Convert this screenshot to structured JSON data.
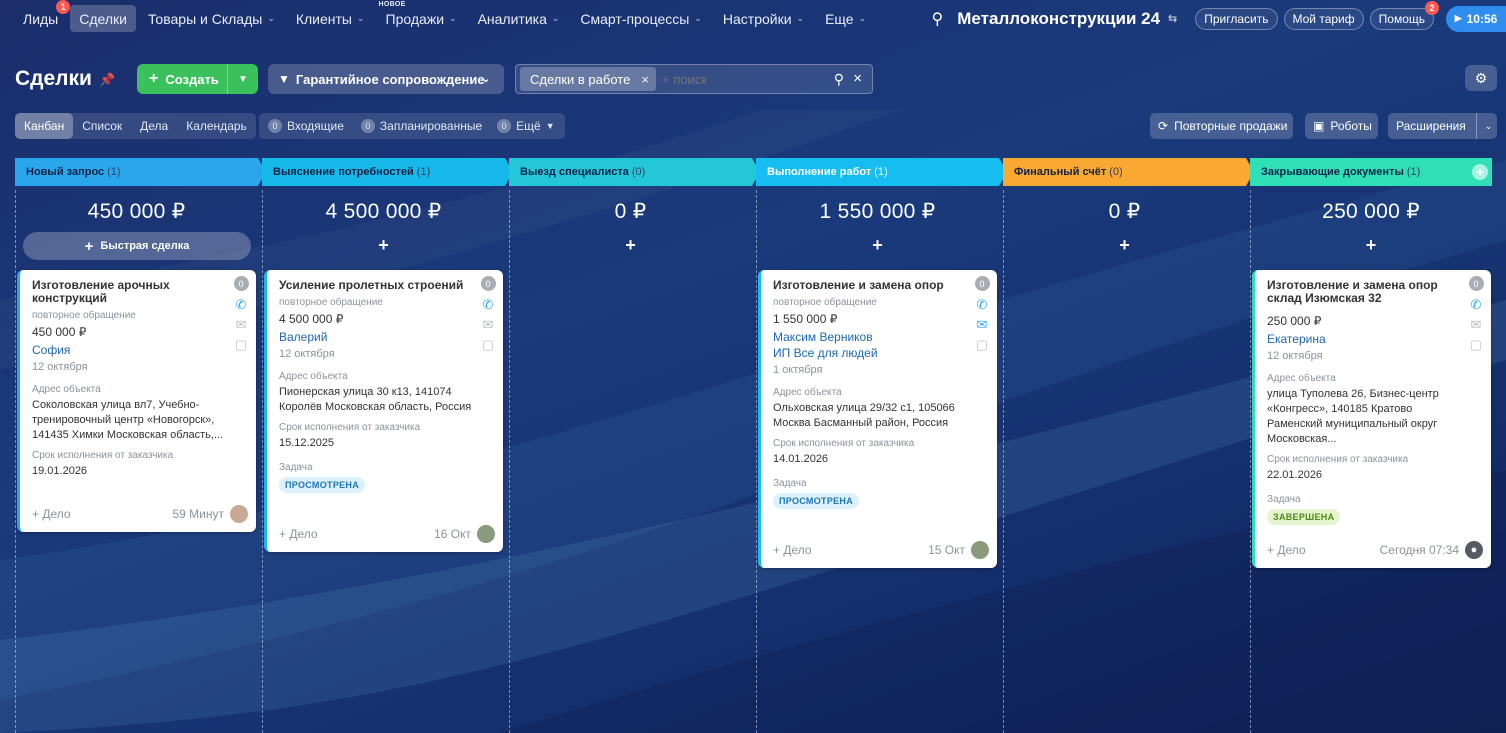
{
  "nav": {
    "items": [
      {
        "label": "Лиды",
        "badge": "1",
        "chev": false,
        "active": false
      },
      {
        "label": "Сделки",
        "badge": "",
        "chev": false,
        "active": true
      },
      {
        "label": "Товары и Склады",
        "badge": "",
        "chev": true,
        "active": false
      },
      {
        "label": "Клиенты",
        "badge": "",
        "chev": true,
        "active": false
      },
      {
        "label": "Продажи",
        "badge": "",
        "chev": true,
        "active": false,
        "tag": "НОВОЕ"
      },
      {
        "label": "Аналитика",
        "badge": "",
        "chev": true,
        "active": false
      },
      {
        "label": "Смарт-процессы",
        "badge": "",
        "chev": true,
        "active": false
      },
      {
        "label": "Настройки",
        "badge": "",
        "chev": true,
        "active": false
      },
      {
        "label": "Еще",
        "badge": "",
        "chev": true,
        "active": false
      }
    ],
    "company": "Металлоконструкции 24",
    "invite": "Пригласить",
    "tariff": "Мой тариф",
    "help": "Помощь",
    "help_badge": "2",
    "clock": "10:56"
  },
  "header": {
    "title": "Сделки",
    "create": "Создать",
    "pipeline": "Гарантийное сопровождение",
    "filter_chip": "Сделки в работе",
    "search_placeholder": "+ поиск"
  },
  "views": [
    "Канбан",
    "Список",
    "Дела",
    "Календарь"
  ],
  "counters": {
    "incoming_count": "0",
    "incoming": "Входящие",
    "planned_count": "0",
    "planned": "Запланированные",
    "more_count": "0",
    "more": "Ещё"
  },
  "actions": {
    "repeat_sales": "Повторные продажи",
    "robots": "Роботы",
    "extensions": "Расширения"
  },
  "colors": {
    "stage1": "#2aa7ec",
    "stage2": "#17b9ea",
    "stage3": "#23c7d8",
    "stage4": "#15bdf0",
    "stage5": "#f9a931",
    "stage6": "#2fdfb7"
  },
  "columns": [
    {
      "name": "Новый запрос",
      "count": "(1)",
      "sum": "450 000 ₽",
      "quick": "Быстрая сделка"
    },
    {
      "name": "Выяснение потребностей",
      "count": "(1)",
      "sum": "4 500 000 ₽"
    },
    {
      "name": "Выезд специалиста",
      "count": "(0)",
      "sum": "0 ₽"
    },
    {
      "name": "Выполнение работ",
      "count": "(1)",
      "sum": "1 550 000 ₽"
    },
    {
      "name": "Финальный счёт",
      "count": "(0)",
      "sum": "0 ₽"
    },
    {
      "name": "Закрывающие документы",
      "count": "(1)",
      "sum": "250 000 ₽"
    }
  ],
  "cards": [
    {
      "title": "Изготовление арочных конструкций",
      "sub": "повторное обращение",
      "sum": "450 000 ₽",
      "contact": "София",
      "date": "12 октября",
      "addr_label": "Адрес объекта",
      "addr": "Соколовская улица вл7, Учебно-тренировочный центр «Новогорск», 141435 Химки Московская область,...",
      "due_label": "Срок исполнения от заказчика",
      "due": "19.01.2026",
      "add": "+ Дело",
      "time": "59 Минут",
      "count": "0"
    },
    {
      "title": "Усиление пролетных строений",
      "sub": "повторное обращение",
      "sum": "4 500 000 ₽",
      "contact": "Валерий",
      "date": "12 октября",
      "addr_label": "Адрес объекта",
      "addr": "Пионерская улица 30 к13, 141074 Королёв Московская область, Россия",
      "due_label": "Срок исполнения от заказчика",
      "due": "15.12.2025",
      "task_label": "Задача",
      "task": "ПРОСМОТРЕНА",
      "add": "+ Дело",
      "time": "16 Окт",
      "count": "0"
    },
    {
      "title": "Изготовление и замена опор",
      "sub": "повторное обращение",
      "sum": "1 550 000 ₽",
      "contact": "Максим Верников",
      "company": "ИП Все для людей",
      "date": "1 октября",
      "addr_label": "Адрес объекта",
      "addr": "Ольховская улица 29/32 с1, 105066 Москва Басманный район, Россия",
      "due_label": "Срок исполнения от заказчика",
      "due": "14.01.2026",
      "task_label": "Задача",
      "task": "ПРОСМОТРЕНА",
      "add": "+ Дело",
      "time": "15 Окт",
      "count": "0"
    },
    {
      "title": "Изготовление и замена опор склад Изюмская 32",
      "sum": "250 000 ₽",
      "contact": "Екатерина",
      "date": "12 октября",
      "addr_label": "Адрес объекта",
      "addr": "улица Туполева 26, Бизнес-центр «Конгресс», 140185 Кратово Раменский муниципальный округ Московская...",
      "due_label": "Срок исполнения от заказчика",
      "due": "22.01.2026",
      "task_label": "Задача",
      "task": "ЗАВЕРШЕНА",
      "add": "+ Дело",
      "time": "Сегодня 07:34",
      "count": "0"
    }
  ]
}
